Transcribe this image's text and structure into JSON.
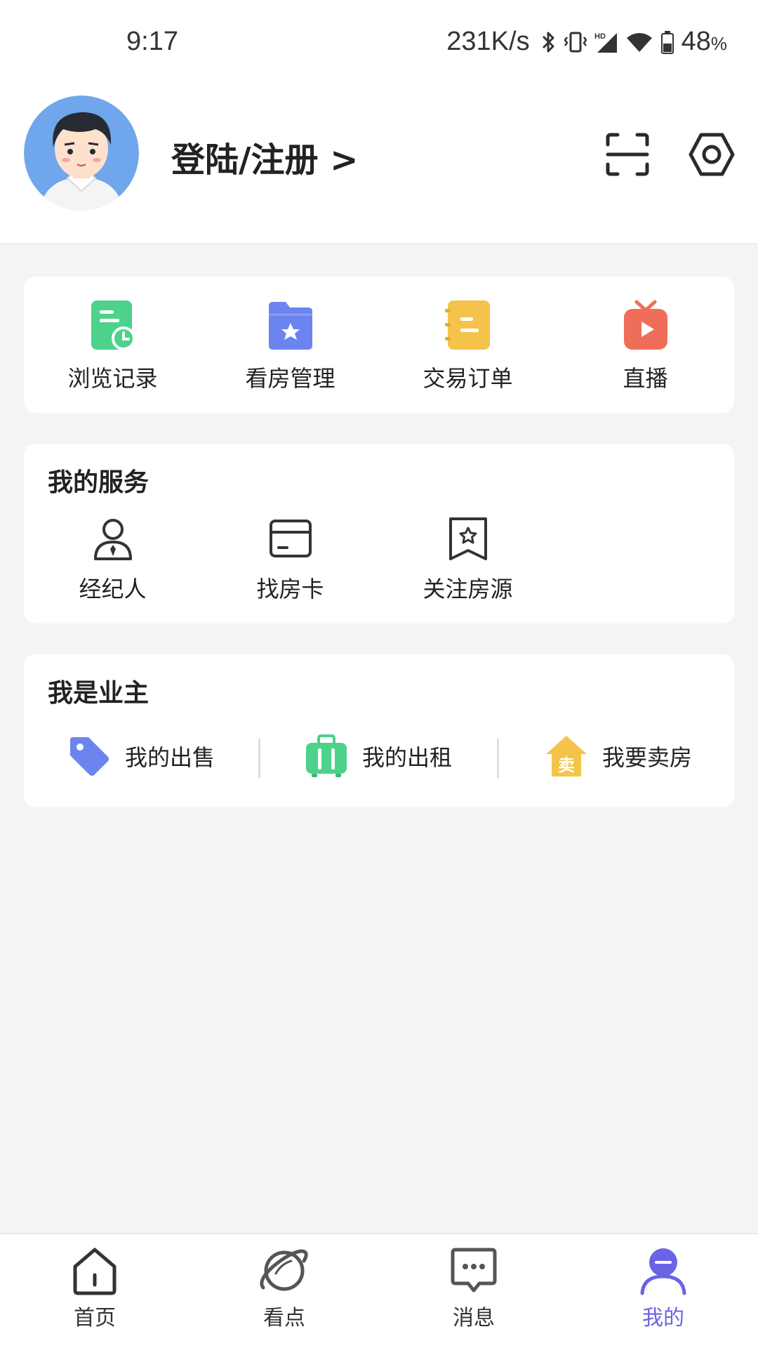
{
  "status_bar": {
    "time": "9:17",
    "network_speed": "231K/s",
    "battery": "48",
    "battery_unit": "%",
    "icons": [
      "bluetooth-icon",
      "vibrate-icon",
      "hd-signal-icon",
      "wifi-icon",
      "battery-icon"
    ]
  },
  "profile": {
    "login_label": "登陆/注册 >",
    "avatar_icon": "user-avatar",
    "scan_icon": "scan-icon",
    "settings_icon": "settings-icon"
  },
  "quick_actions": [
    {
      "label": "浏览记录",
      "icon": "history-icon",
      "color": "#4cd28a"
    },
    {
      "label": "看房管理",
      "icon": "folder-star-icon",
      "color": "#6b84f0"
    },
    {
      "label": "交易订单",
      "icon": "order-book-icon",
      "color": "#f5c34a"
    },
    {
      "label": "直播",
      "icon": "live-tv-icon",
      "color": "#ee6e5a"
    }
  ],
  "services": {
    "title": "我的服务",
    "items": [
      {
        "label": "经纪人",
        "icon": "agent-icon"
      },
      {
        "label": "找房卡",
        "icon": "card-icon"
      },
      {
        "label": "关注房源",
        "icon": "bookmark-star-icon"
      }
    ]
  },
  "owner": {
    "title": "我是业主",
    "items": [
      {
        "label": "我的出售",
        "icon": "tag-icon",
        "color": "#6b84f0"
      },
      {
        "label": "我的出租",
        "icon": "suitcase-icon",
        "color": "#4cd28a"
      },
      {
        "label": "我要卖房",
        "icon": "sell-house-icon",
        "color": "#f5c34a",
        "badge": "卖"
      }
    ]
  },
  "tabbar": {
    "items": [
      {
        "label": "首页",
        "icon": "home-icon"
      },
      {
        "label": "看点",
        "icon": "planet-icon"
      },
      {
        "label": "消息",
        "icon": "message-icon"
      },
      {
        "label": "我的",
        "icon": "profile-icon"
      }
    ],
    "active_color": "#6b63e6"
  }
}
